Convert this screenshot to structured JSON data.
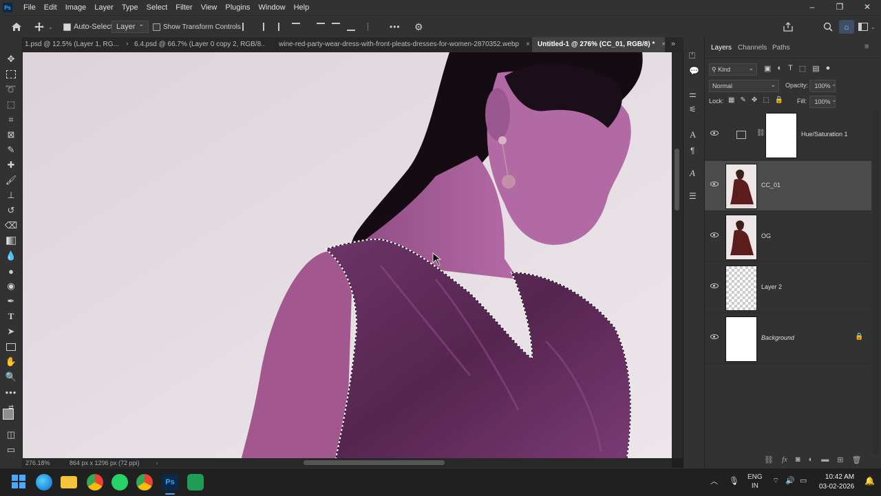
{
  "app": {
    "logo": "Ps"
  },
  "menu": {
    "items": [
      "File",
      "Edit",
      "Image",
      "Layer",
      "Type",
      "Select",
      "Filter",
      "View",
      "Plugins",
      "Window",
      "Help"
    ]
  },
  "window_controls": {
    "minimize": "–",
    "restore": "❐",
    "close": "✕"
  },
  "options_bar": {
    "auto_select_label": "Auto-Select:",
    "auto_select_checked": true,
    "auto_select_target": "Layer",
    "transform_controls_label": "Show Transform Controls",
    "more_label": "•••"
  },
  "tabs": [
    {
      "label": "1.psd @ 12.5% (Layer 1, RG...",
      "active": false
    },
    {
      "label": "6.4.psd @ 66.7% (Layer 0 copy 2, RGB/8...",
      "active": false
    },
    {
      "label": "wine-red-party-wear-dress-with-front-pleats-dresses-for-women-2870352.webp",
      "active": false
    },
    {
      "label": "Untitled-1 @ 276% (CC_01, RGB/8) *",
      "active": true
    }
  ],
  "tab_close": "×",
  "status": {
    "zoom": "276.18%",
    "doc_size": "864 px x 1296 px (72 ppi)"
  },
  "panels": {
    "tabs": [
      "Layers",
      "Channels",
      "Paths"
    ],
    "filter_kind": "Kind",
    "blend_mode": "Normal",
    "opacity_label": "Opacity:",
    "opacity_value": "100%",
    "lock_label": "Lock:",
    "fill_label": "Fill:",
    "fill_value": "100%"
  },
  "layers": [
    {
      "name": "Hue/Saturation 1",
      "type": "adjustment",
      "selected": false
    },
    {
      "name": "CC_01",
      "type": "photo",
      "selected": true
    },
    {
      "name": "OG",
      "type": "photo",
      "selected": false
    },
    {
      "name": "Layer 2",
      "type": "transparent",
      "selected": false
    },
    {
      "name": "Background",
      "type": "white",
      "selected": false,
      "locked": true
    }
  ],
  "taskbar": {
    "lang_top": "ENG",
    "lang_bottom": "IN",
    "time": "10:42 AM",
    "date": "03-02-2026"
  },
  "colors": {
    "accent": "#31a8ff",
    "canvas_bg": "#e4dce2",
    "skin": "#a0508f",
    "dress": "#5c2a58"
  }
}
